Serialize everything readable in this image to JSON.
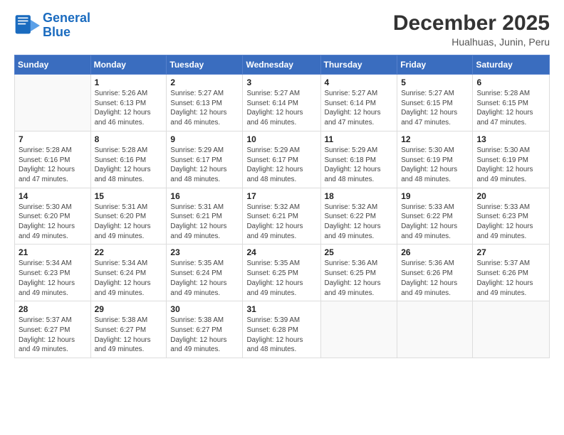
{
  "logo": {
    "line1": "General",
    "line2": "Blue"
  },
  "title": "December 2025",
  "subtitle": "Hualhuas, Junin, Peru",
  "days_of_week": [
    "Sunday",
    "Monday",
    "Tuesday",
    "Wednesday",
    "Thursday",
    "Friday",
    "Saturday"
  ],
  "weeks": [
    [
      {
        "day": "",
        "info": ""
      },
      {
        "day": "1",
        "info": "Sunrise: 5:26 AM\nSunset: 6:13 PM\nDaylight: 12 hours\nand 46 minutes."
      },
      {
        "day": "2",
        "info": "Sunrise: 5:27 AM\nSunset: 6:13 PM\nDaylight: 12 hours\nand 46 minutes."
      },
      {
        "day": "3",
        "info": "Sunrise: 5:27 AM\nSunset: 6:14 PM\nDaylight: 12 hours\nand 46 minutes."
      },
      {
        "day": "4",
        "info": "Sunrise: 5:27 AM\nSunset: 6:14 PM\nDaylight: 12 hours\nand 47 minutes."
      },
      {
        "day": "5",
        "info": "Sunrise: 5:27 AM\nSunset: 6:15 PM\nDaylight: 12 hours\nand 47 minutes."
      },
      {
        "day": "6",
        "info": "Sunrise: 5:28 AM\nSunset: 6:15 PM\nDaylight: 12 hours\nand 47 minutes."
      }
    ],
    [
      {
        "day": "7",
        "info": "Sunrise: 5:28 AM\nSunset: 6:16 PM\nDaylight: 12 hours\nand 47 minutes."
      },
      {
        "day": "8",
        "info": "Sunrise: 5:28 AM\nSunset: 6:16 PM\nDaylight: 12 hours\nand 48 minutes."
      },
      {
        "day": "9",
        "info": "Sunrise: 5:29 AM\nSunset: 6:17 PM\nDaylight: 12 hours\nand 48 minutes."
      },
      {
        "day": "10",
        "info": "Sunrise: 5:29 AM\nSunset: 6:17 PM\nDaylight: 12 hours\nand 48 minutes."
      },
      {
        "day": "11",
        "info": "Sunrise: 5:29 AM\nSunset: 6:18 PM\nDaylight: 12 hours\nand 48 minutes."
      },
      {
        "day": "12",
        "info": "Sunrise: 5:30 AM\nSunset: 6:19 PM\nDaylight: 12 hours\nand 48 minutes."
      },
      {
        "day": "13",
        "info": "Sunrise: 5:30 AM\nSunset: 6:19 PM\nDaylight: 12 hours\nand 49 minutes."
      }
    ],
    [
      {
        "day": "14",
        "info": "Sunrise: 5:30 AM\nSunset: 6:20 PM\nDaylight: 12 hours\nand 49 minutes."
      },
      {
        "day": "15",
        "info": "Sunrise: 5:31 AM\nSunset: 6:20 PM\nDaylight: 12 hours\nand 49 minutes."
      },
      {
        "day": "16",
        "info": "Sunrise: 5:31 AM\nSunset: 6:21 PM\nDaylight: 12 hours\nand 49 minutes."
      },
      {
        "day": "17",
        "info": "Sunrise: 5:32 AM\nSunset: 6:21 PM\nDaylight: 12 hours\nand 49 minutes."
      },
      {
        "day": "18",
        "info": "Sunrise: 5:32 AM\nSunset: 6:22 PM\nDaylight: 12 hours\nand 49 minutes."
      },
      {
        "day": "19",
        "info": "Sunrise: 5:33 AM\nSunset: 6:22 PM\nDaylight: 12 hours\nand 49 minutes."
      },
      {
        "day": "20",
        "info": "Sunrise: 5:33 AM\nSunset: 6:23 PM\nDaylight: 12 hours\nand 49 minutes."
      }
    ],
    [
      {
        "day": "21",
        "info": "Sunrise: 5:34 AM\nSunset: 6:23 PM\nDaylight: 12 hours\nand 49 minutes."
      },
      {
        "day": "22",
        "info": "Sunrise: 5:34 AM\nSunset: 6:24 PM\nDaylight: 12 hours\nand 49 minutes."
      },
      {
        "day": "23",
        "info": "Sunrise: 5:35 AM\nSunset: 6:24 PM\nDaylight: 12 hours\nand 49 minutes."
      },
      {
        "day": "24",
        "info": "Sunrise: 5:35 AM\nSunset: 6:25 PM\nDaylight: 12 hours\nand 49 minutes."
      },
      {
        "day": "25",
        "info": "Sunrise: 5:36 AM\nSunset: 6:25 PM\nDaylight: 12 hours\nand 49 minutes."
      },
      {
        "day": "26",
        "info": "Sunrise: 5:36 AM\nSunset: 6:26 PM\nDaylight: 12 hours\nand 49 minutes."
      },
      {
        "day": "27",
        "info": "Sunrise: 5:37 AM\nSunset: 6:26 PM\nDaylight: 12 hours\nand 49 minutes."
      }
    ],
    [
      {
        "day": "28",
        "info": "Sunrise: 5:37 AM\nSunset: 6:27 PM\nDaylight: 12 hours\nand 49 minutes."
      },
      {
        "day": "29",
        "info": "Sunrise: 5:38 AM\nSunset: 6:27 PM\nDaylight: 12 hours\nand 49 minutes."
      },
      {
        "day": "30",
        "info": "Sunrise: 5:38 AM\nSunset: 6:27 PM\nDaylight: 12 hours\nand 49 minutes."
      },
      {
        "day": "31",
        "info": "Sunrise: 5:39 AM\nSunset: 6:28 PM\nDaylight: 12 hours\nand 48 minutes."
      },
      {
        "day": "",
        "info": ""
      },
      {
        "day": "",
        "info": ""
      },
      {
        "day": "",
        "info": ""
      }
    ]
  ]
}
